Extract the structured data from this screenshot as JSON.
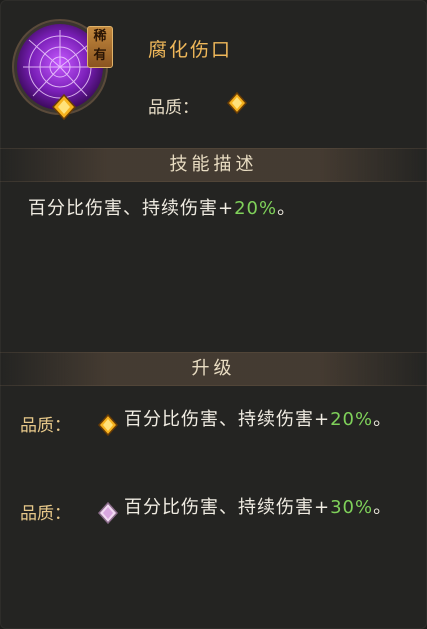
{
  "skill": {
    "name": "腐化伤口",
    "rarity_badge": "稀有",
    "icon": "spider-web-icon",
    "quality_label": "品质：",
    "quality_gem": "gold-gem-icon"
  },
  "sections": {
    "description_title": "技能描述",
    "upgrade_title": "升级"
  },
  "description": {
    "text_prefix": "百分比伤害、持续伤害+",
    "value": "20%",
    "text_suffix": "。"
  },
  "upgrades": [
    {
      "label": "品质：",
      "gem": "gold-gem-icon",
      "text_prefix": "百分比伤害、持续伤害+",
      "value": "20%",
      "text_suffix": "。"
    },
    {
      "label": "品质：",
      "gem": "pink-crystal-icon",
      "text_prefix": "百分比伤害、持续伤害+",
      "value": "30%",
      "text_suffix": "。"
    }
  ],
  "colors": {
    "name": "#f0b85a",
    "highlight_value": "#7fd15a",
    "label": "#e8c98a",
    "background": "#242422"
  }
}
